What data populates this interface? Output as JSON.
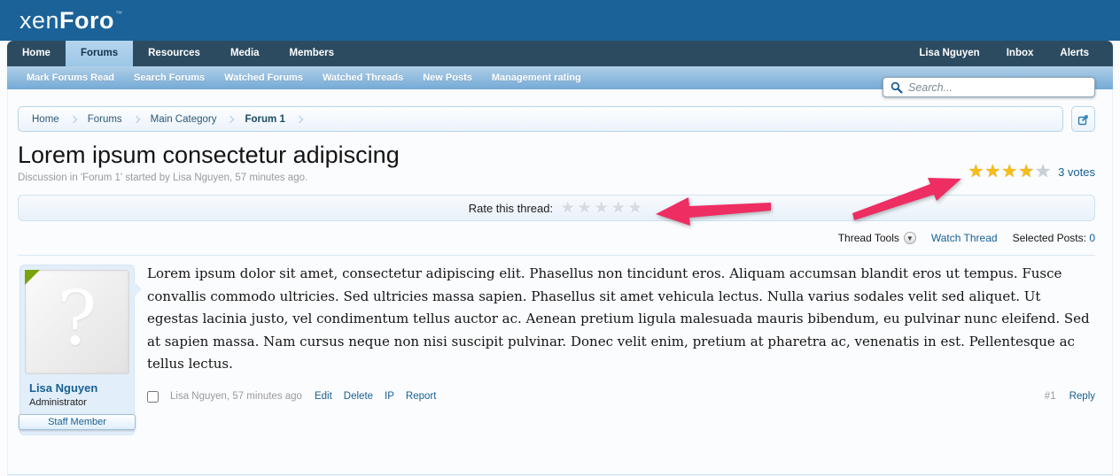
{
  "colors": {
    "header_blue": "#1a6298",
    "nav_dark": "#2c4b61",
    "subnav_gradient_top": "#b0cfe8",
    "subnav_gradient_bottom": "#74aad6",
    "link_blue": "#176093",
    "star_gold": "#f5bd16",
    "star_empty": "#c9cfd6",
    "annotation_pink": "#ee2d62",
    "avatar_corner_green": "#7aa30b"
  },
  "brand": {
    "logo_part1": "xen",
    "logo_part2": "Foro",
    "trademark": "™"
  },
  "nav": {
    "tabs": [
      {
        "label": "Home"
      },
      {
        "label": "Forums"
      },
      {
        "label": "Resources"
      },
      {
        "label": "Media"
      },
      {
        "label": "Members"
      }
    ],
    "user_links": [
      {
        "label": "Lisa Nguyen"
      },
      {
        "label": "Inbox"
      },
      {
        "label": "Alerts"
      }
    ]
  },
  "subnav": {
    "links": [
      {
        "label": "Mark Forums Read"
      },
      {
        "label": "Search Forums"
      },
      {
        "label": "Watched Forums"
      },
      {
        "label": "Watched Threads"
      },
      {
        "label": "New Posts"
      },
      {
        "label": "Management rating"
      }
    ]
  },
  "search": {
    "placeholder": "Search..."
  },
  "breadcrumb": {
    "items": [
      {
        "label": "Home"
      },
      {
        "label": "Forums"
      },
      {
        "label": "Main Category"
      },
      {
        "label": "Forum 1"
      }
    ]
  },
  "thread": {
    "title": "Lorem ipsum consectetur adipiscing",
    "meta": "Discussion in 'Forum 1' started by Lisa Nguyen, 57 minutes ago.",
    "rating": {
      "stars_gold": "★★★★",
      "stars_empty": "★",
      "votes": "3 votes"
    },
    "rate_prompt": "Rate this thread:",
    "rate_stars": "★★★★★",
    "tools": {
      "thread_tools": "Thread Tools",
      "dropdown_glyph": "▼",
      "watch_thread": "Watch Thread",
      "selected_posts_label": "Selected Posts:",
      "selected_posts_count": "0"
    }
  },
  "post": {
    "author": "Lisa Nguyen",
    "author_role": "Administrator",
    "staff_banner": "Staff Member",
    "avatar_glyph": "?",
    "body": "Lorem ipsum dolor sit amet, consectetur adipiscing elit. Phasellus non tincidunt eros. Aliquam accumsan blandit eros ut tempus. Fusce convallis commodo ultricies. Sed ultricies massa sapien. Phasellus sit amet vehicula lectus. Nulla varius sodales velit sed aliquet. Ut egestas lacinia justo, vel condimentum tellus auctor ac. Aenean pretium ligula malesuada mauris bibendum, eu pulvinar nunc eleifend. Sed at sapien massa. Nam cursus neque non nisi suscipit pulvinar. Donec velit enim, pretium at pharetra ac, venenatis in est. Pellentesque ac tellus lectus.",
    "footer": {
      "byline": "Lisa Nguyen, 57 minutes ago",
      "actions": [
        {
          "label": "Edit"
        },
        {
          "label": "Delete"
        },
        {
          "label": "IP"
        },
        {
          "label": "Report"
        }
      ],
      "post_number": "#1",
      "reply": "Reply"
    }
  }
}
